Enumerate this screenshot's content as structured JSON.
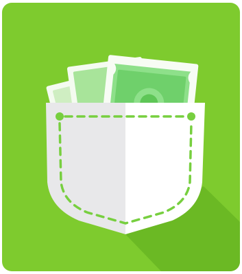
{
  "app_icon": {
    "name": "money-pocket-app-icon",
    "colors": {
      "background": "#7ecb2e",
      "long_shadow": "#6bb924",
      "pocket_left": "#e8e8ea",
      "pocket_right": "#ffffff",
      "stitch": "#77cf3f",
      "banknote_light": "#cfeec2",
      "banknote_mid": "#a8e49a",
      "banknote_dark": "#5ec657",
      "banknote_face": "#8ee08a"
    },
    "banknote_count": 3
  }
}
